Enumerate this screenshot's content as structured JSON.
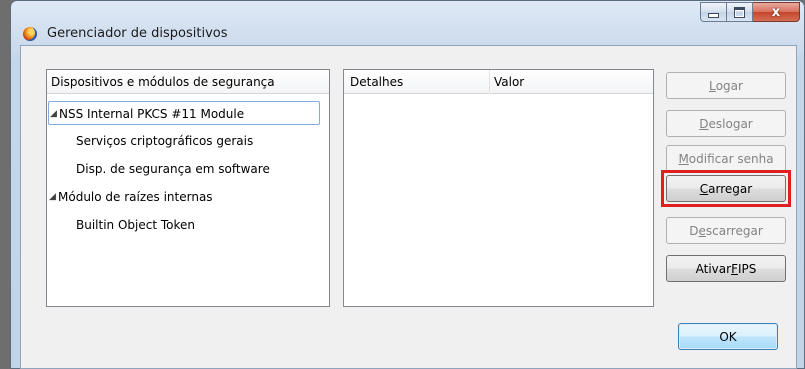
{
  "window": {
    "title": "Gerenciador de dispositivos",
    "caption_close": "x"
  },
  "tree": {
    "header": "Dispositivos e módulos de segurança",
    "expander_glyph": "◢",
    "items": [
      {
        "label": "NSS Internal PKCS #11 Module",
        "level": 0,
        "expanded": true,
        "selected": true
      },
      {
        "label": "Serviços criptográficos gerais",
        "level": 1
      },
      {
        "label": "Disp. de segurança em software",
        "level": 1
      },
      {
        "label": "Módulo de raízes internas",
        "level": 0,
        "expanded": true
      },
      {
        "label": "Builtin Object Token",
        "level": 1
      }
    ]
  },
  "details": {
    "columns": [
      "Detalhes",
      "Valor"
    ]
  },
  "buttons": {
    "logar": {
      "pre": "",
      "accel": "L",
      "post": "ogar",
      "enabled": false
    },
    "deslogar": {
      "pre": "",
      "accel": "D",
      "post": "eslogar",
      "enabled": false
    },
    "modificar_senha": {
      "pre": "",
      "accel": "M",
      "post": "odificar senha",
      "enabled": false
    },
    "carregar": {
      "pre": "",
      "accel": "C",
      "post": "arregar",
      "enabled": true,
      "highlighted": true,
      "highlight_color": "#e02020"
    },
    "descarregar": {
      "pre": "D",
      "accel": "e",
      "post": "scarregar",
      "enabled": false
    },
    "ativar_fips": {
      "pre": "Ativar ",
      "accel": "F",
      "post": "IPS",
      "enabled": true
    },
    "ok": {
      "pre": "",
      "accel": "",
      "post": "OK",
      "enabled": true,
      "default": true
    }
  }
}
